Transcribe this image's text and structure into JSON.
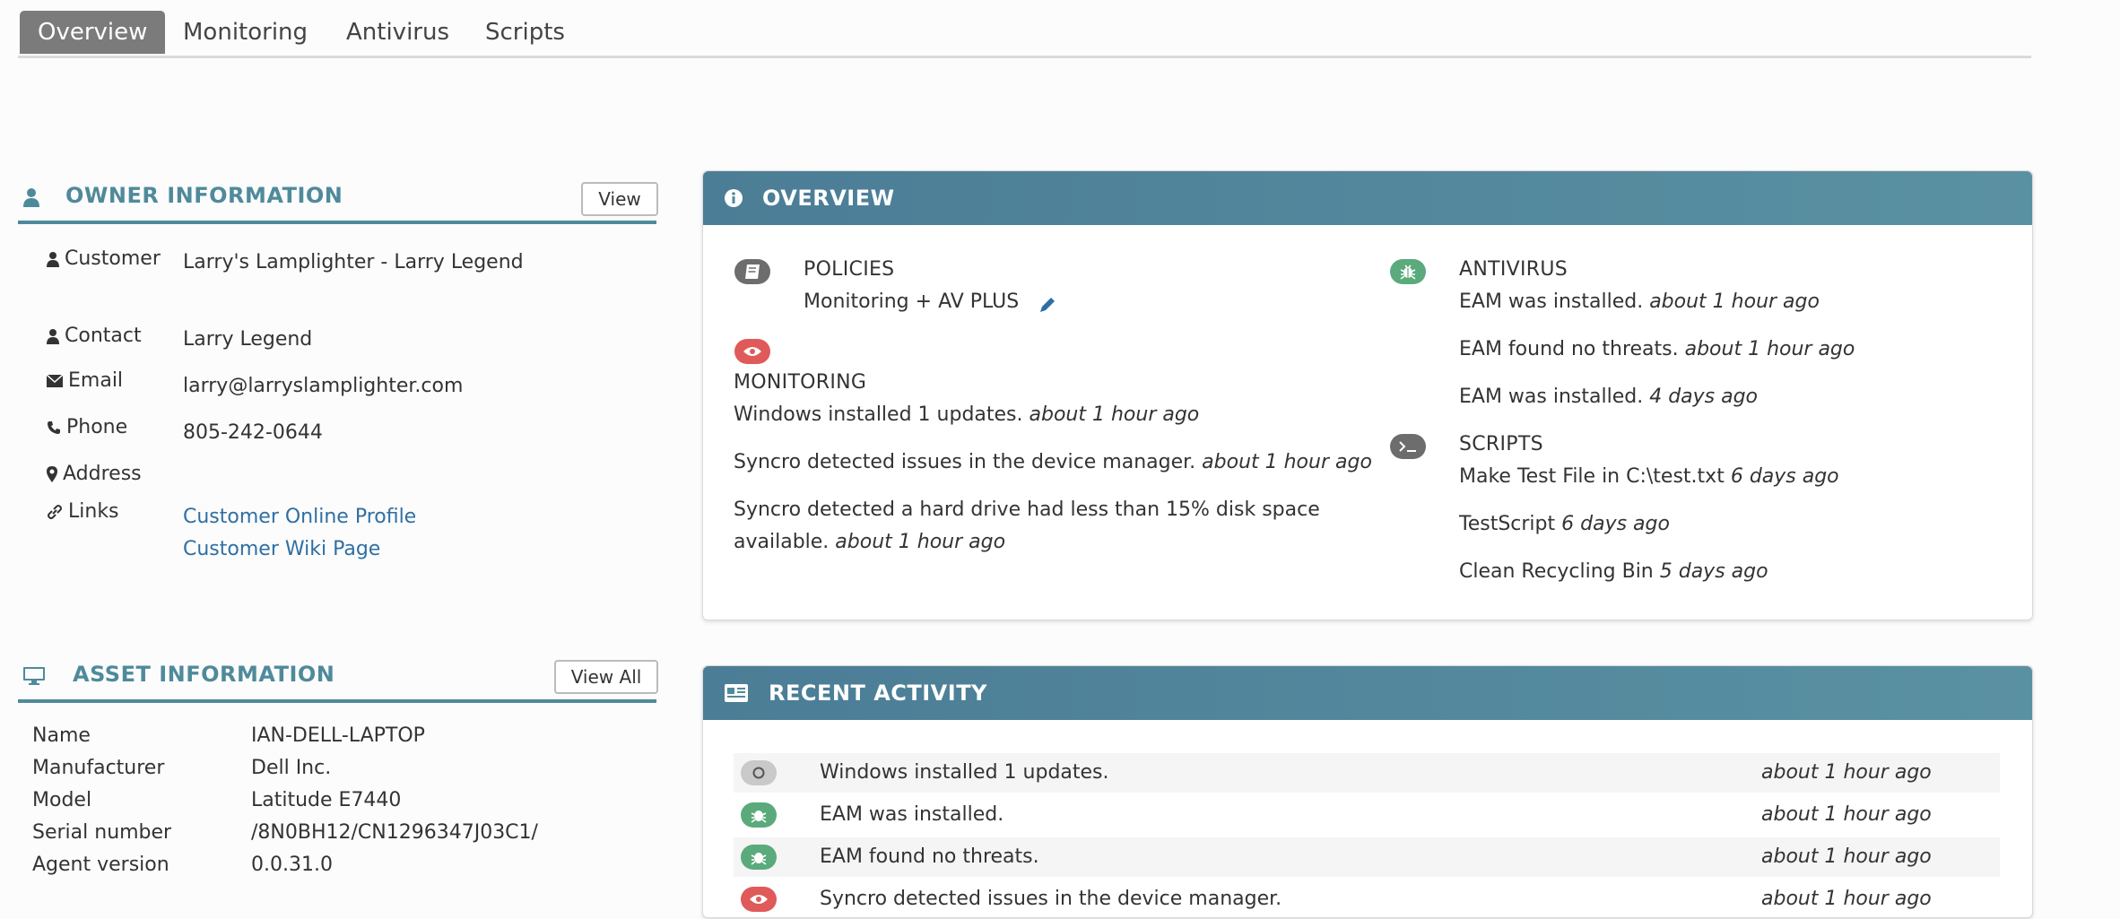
{
  "tabs": [
    "Overview",
    "Monitoring",
    "Antivirus",
    "Scripts"
  ],
  "owner": {
    "title": "OWNER INFORMATION",
    "view_label": "View",
    "customer_label": "Customer",
    "customer_value": "Larry's Lamplighter - Larry Legend",
    "contact_label": "Contact",
    "contact_value": "Larry Legend",
    "email_label": "Email",
    "email_value": "larry@larryslamplighter.com",
    "phone_label": "Phone",
    "phone_value": "805-242-0644",
    "address_label": "Address",
    "links_label": "Links",
    "link1": "Customer Online Profile",
    "link2": "Customer Wiki Page"
  },
  "asset": {
    "title": "ASSET INFORMATION",
    "view_all_label": "View All",
    "rows": [
      {
        "label": "Name",
        "value": "IAN-DELL-LAPTOP"
      },
      {
        "label": "Manufacturer",
        "value": "Dell Inc."
      },
      {
        "label": "Model",
        "value": "Latitude E7440"
      },
      {
        "label": "Serial number",
        "value": "/8N0BH12/CN1296347J03C1/"
      },
      {
        "label": "Agent version",
        "value": "0.0.31.0"
      }
    ]
  },
  "overview": {
    "title": "OVERVIEW",
    "policies_title": "POLICIES",
    "policy_value": "Monitoring + AV PLUS",
    "monitoring_title": "MONITORING",
    "monitoring": [
      {
        "text": "Windows installed 1 updates.",
        "time": "about 1 hour ago"
      },
      {
        "text": "Syncro detected issues in the device manager.",
        "time": "about 1 hour ago"
      },
      {
        "text": "Syncro detected a hard drive had less than 15% disk space",
        "text2": "available.",
        "time": "about 1 hour ago"
      }
    ],
    "antivirus_title": "ANTIVIRUS",
    "antivirus": [
      {
        "text": "EAM was installed.",
        "time": "about 1 hour ago"
      },
      {
        "text": "EAM found no threats.",
        "time": "about 1 hour ago"
      },
      {
        "text": "EAM was installed.",
        "time": "4 days ago"
      }
    ],
    "scripts_title": "SCRIPTS",
    "scripts": [
      {
        "text": "Make Test File in C:\\test.txt",
        "time": "6 days ago"
      },
      {
        "text": "TestScript",
        "time": "6 days ago"
      },
      {
        "text": "Clean Recycling Bin",
        "time": "5 days ago"
      }
    ]
  },
  "recent": {
    "title": "RECENT ACTIVITY",
    "rows": [
      {
        "text": "Windows installed 1 updates.",
        "time": "about 1 hour ago",
        "icon": "circle-icon"
      },
      {
        "text": "EAM was installed.",
        "time": "about 1 hour ago",
        "icon": "bug-icon"
      },
      {
        "text": "EAM found no threats.",
        "time": "about 1 hour ago",
        "icon": "bug-icon"
      },
      {
        "text": "Syncro detected issues in the device manager.",
        "time": "about 1 hour ago",
        "icon": "eye-icon"
      }
    ]
  },
  "colors": {
    "header_blue": "#4f8a9b",
    "green": "#5aaa7c",
    "red": "#e05a5a",
    "gray": "#6d6d6d",
    "link": "#2f6fa3"
  }
}
